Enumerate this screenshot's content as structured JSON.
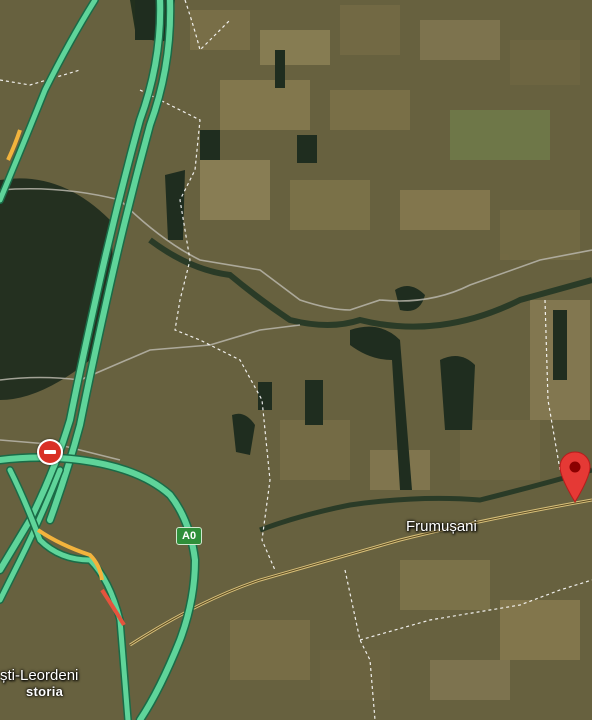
{
  "map": {
    "type": "satellite",
    "labels": {
      "frumusani": "Frumușani",
      "leordeni": "ști-Leordeni"
    },
    "road_shield": "A0",
    "watermark": "storia",
    "icons": {
      "marker": "location-pin-icon",
      "no_entry": "no-entry-icon"
    },
    "colors": {
      "traffic_fast": "#5fd49a",
      "traffic_slow": "#f2b33d",
      "traffic_jam": "#e5533d",
      "marker": "#e53935",
      "road_local": "#c8b27a",
      "boundary": "#ffffff"
    }
  }
}
